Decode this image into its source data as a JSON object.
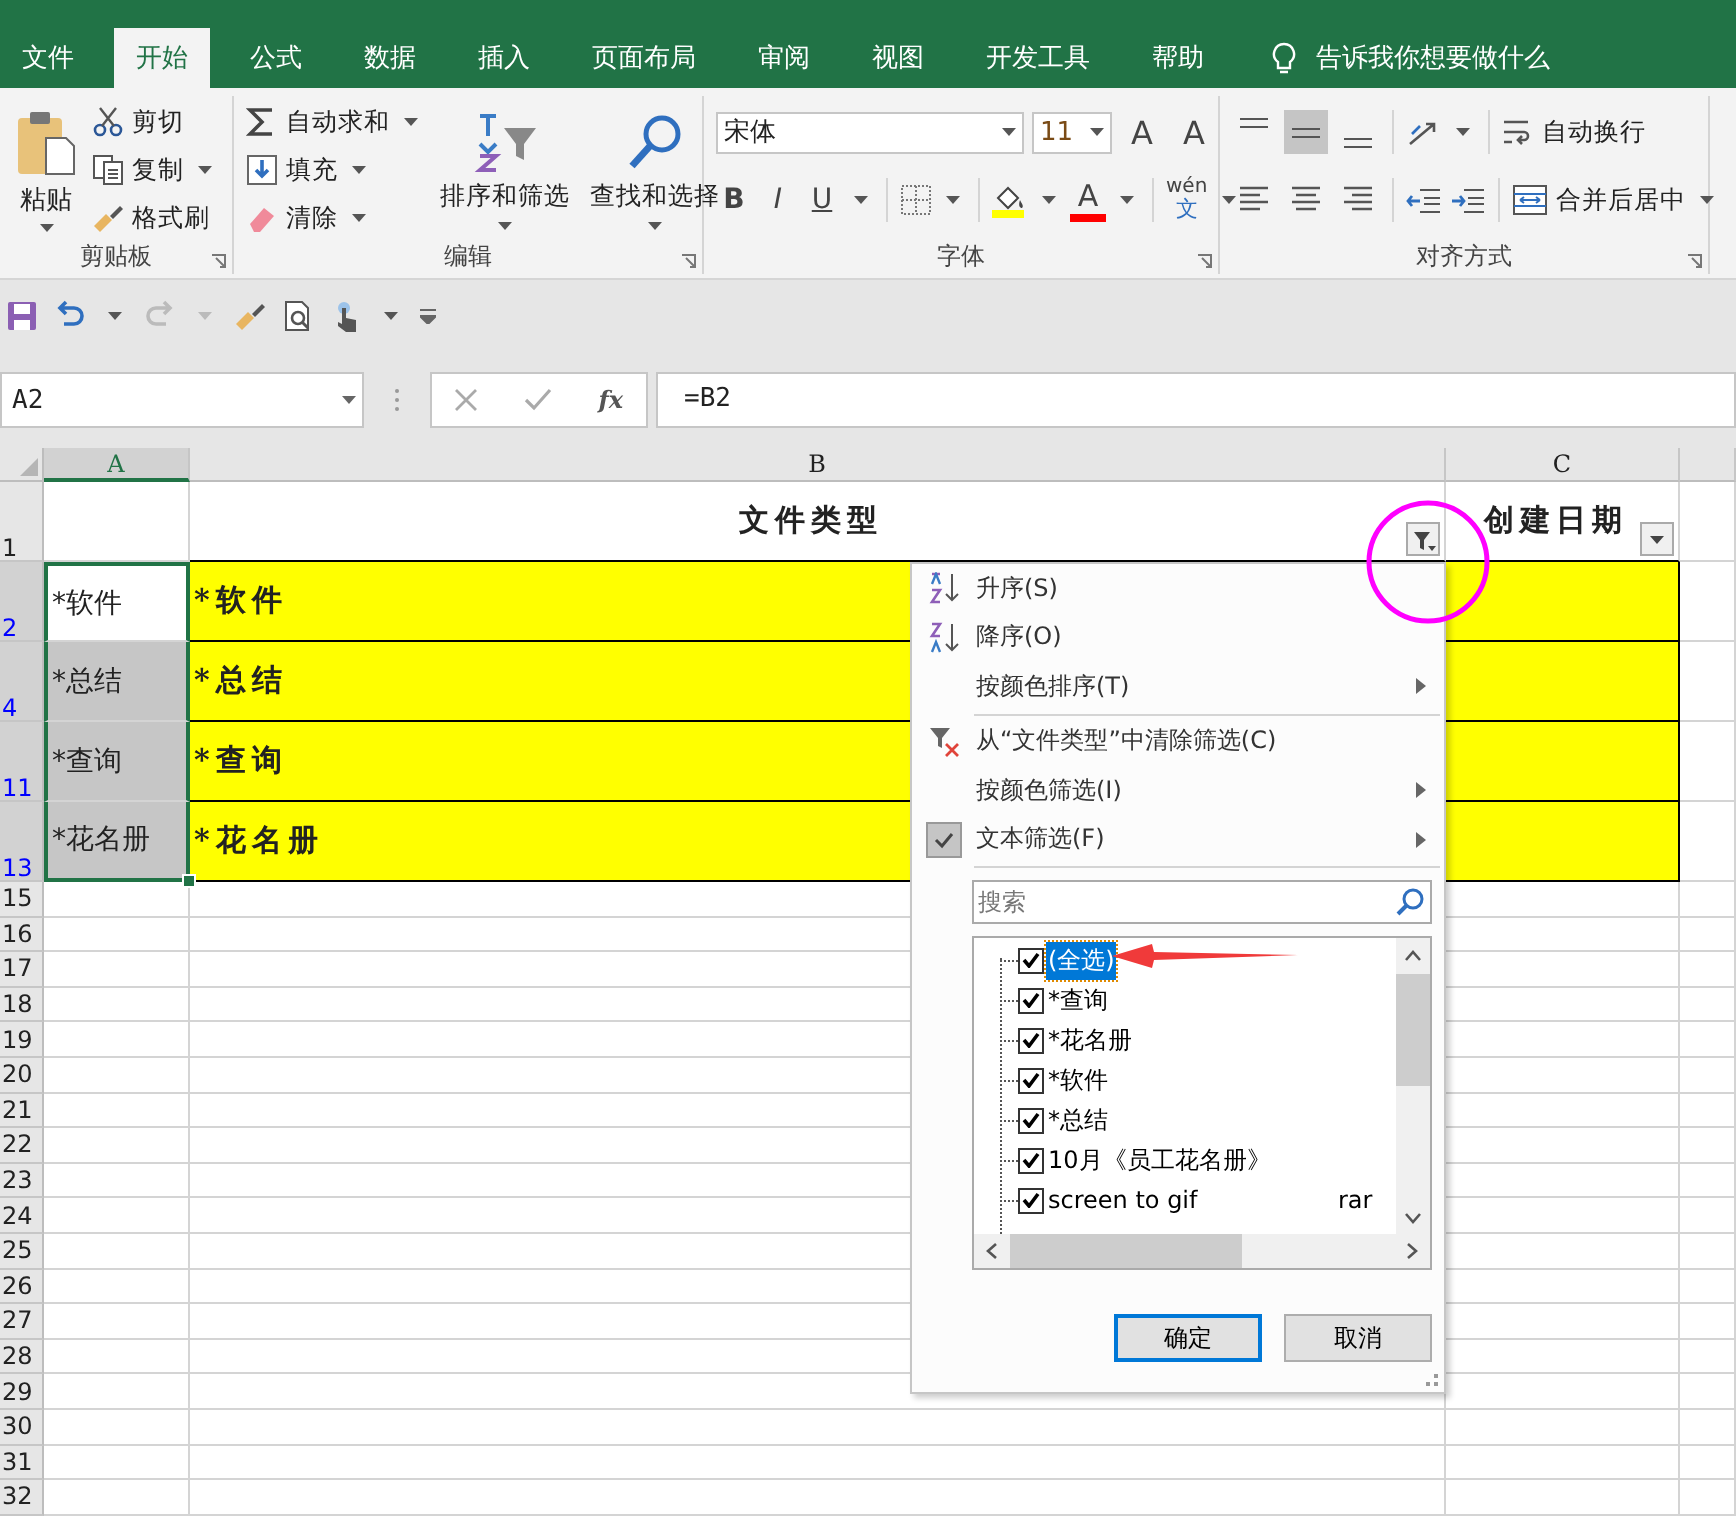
{
  "ribbon_tabs": [
    {
      "label": "文件",
      "selected": false
    },
    {
      "label": "开始",
      "selected": true
    },
    {
      "label": "公式",
      "selected": false
    },
    {
      "label": "数据",
      "selected": false
    },
    {
      "label": "插入",
      "selected": false
    },
    {
      "label": "页面布局",
      "selected": false
    },
    {
      "label": "审阅",
      "selected": false
    },
    {
      "label": "视图",
      "selected": false
    },
    {
      "label": "开发工具",
      "selected": false
    },
    {
      "label": "帮助",
      "selected": false
    }
  ],
  "tell_me": "告诉我你想要做什么",
  "clipboard": {
    "title": "剪贴板",
    "paste": "粘贴",
    "cut": "剪切",
    "copy": "复制",
    "format_painter": "格式刷"
  },
  "editing": {
    "title": "编辑",
    "autosum": "自动求和",
    "fill": "填充",
    "clear": "清除",
    "sort_filter": "排序和筛选",
    "find_select": "查找和选择"
  },
  "font": {
    "title": "字体",
    "name": "宋体",
    "size": "11",
    "grow": "A",
    "shrink": "A",
    "bold": "B",
    "italic": "I",
    "underline": "U",
    "font_color": "A",
    "phonetic_top": "wén",
    "phonetic_bottom": "文"
  },
  "alignment": {
    "title": "对齐方式",
    "wrap": "自动换行",
    "merge": "合并后居中",
    "vertical": [
      {
        "kind": "top",
        "selected": false
      },
      {
        "kind": "middle",
        "selected": true
      },
      {
        "kind": "bottom",
        "selected": false
      }
    ],
    "horizontal": [
      {
        "kind": "left",
        "selected": false
      },
      {
        "kind": "center",
        "selected": false
      },
      {
        "kind": "right",
        "selected": false
      }
    ]
  },
  "formula_bar": {
    "name_box": "A2",
    "fx": "fx",
    "formula": "=B2"
  },
  "sheet": {
    "columns": [
      {
        "label": "A",
        "selected": true
      },
      {
        "label": "B",
        "selected": false
      },
      {
        "label": "C",
        "selected": false
      }
    ],
    "rows": [
      {
        "num": "1",
        "kind": "header",
        "filtered": false,
        "cells": [
          {
            "selected": false
          },
          {
            "text": "文件类型",
            "filter_applied": true
          },
          {
            "text": "创建日期",
            "filter_applied": false
          }
        ]
      },
      {
        "num": "2",
        "kind": "data",
        "filtered": true,
        "cells": [
          {
            "text": "*软件",
            "selected": true,
            "active": true
          },
          {
            "text": "*软件",
            "highlighted": true
          },
          {
            "highlighted": true
          }
        ]
      },
      {
        "num": "4",
        "kind": "data",
        "filtered": true,
        "cells": [
          {
            "text": "*总结",
            "selected": true,
            "active": false
          },
          {
            "text": "*总结",
            "highlighted": true
          },
          {
            "highlighted": true
          }
        ]
      },
      {
        "num": "11",
        "kind": "data",
        "filtered": true,
        "cells": [
          {
            "text": "*查询",
            "selected": true,
            "active": false
          },
          {
            "text": "*查询",
            "highlighted": true
          },
          {
            "highlighted": true
          }
        ]
      },
      {
        "num": "13",
        "kind": "data",
        "filtered": true,
        "cells": [
          {
            "text": "*花名册",
            "selected": true,
            "active": false
          },
          {
            "text": "*花名册",
            "highlighted": true
          },
          {
            "highlighted": true
          }
        ]
      },
      {
        "num": "15",
        "kind": "empty",
        "filtered": false
      },
      {
        "num": "16",
        "kind": "empty",
        "filtered": false
      },
      {
        "num": "17",
        "kind": "empty",
        "filtered": false
      },
      {
        "num": "18",
        "kind": "empty",
        "filtered": false
      },
      {
        "num": "19",
        "kind": "empty",
        "filtered": false
      },
      {
        "num": "20",
        "kind": "empty",
        "filtered": false
      },
      {
        "num": "21",
        "kind": "empty",
        "filtered": false
      },
      {
        "num": "22",
        "kind": "empty",
        "filtered": false
      },
      {
        "num": "23",
        "kind": "empty",
        "filtered": false
      },
      {
        "num": "24",
        "kind": "empty",
        "filtered": false
      },
      {
        "num": "25",
        "kind": "empty",
        "filtered": false
      },
      {
        "num": "26",
        "kind": "empty",
        "filtered": false
      },
      {
        "num": "27",
        "kind": "empty",
        "filtered": false
      },
      {
        "num": "28",
        "kind": "empty",
        "filtered": false
      },
      {
        "num": "29",
        "kind": "empty",
        "filtered": false
      },
      {
        "num": "30",
        "kind": "empty",
        "filtered": false
      },
      {
        "num": "31",
        "kind": "empty",
        "filtered": false
      },
      {
        "num": "32",
        "kind": "empty",
        "filtered": false
      }
    ]
  },
  "filter_menu": {
    "items": [
      {
        "kind": "sort-asc",
        "label": "升序(S)",
        "submenu": false,
        "checked": false
      },
      {
        "kind": "sort-desc",
        "label": "降序(O)",
        "submenu": false,
        "checked": false
      },
      {
        "kind": "plain",
        "label": "按颜色排序(T)",
        "submenu": true,
        "checked": false
      },
      {
        "kind": "separator"
      },
      {
        "kind": "clear-filter",
        "label": "从“文件类型”中清除筛选(C)",
        "submenu": false,
        "checked": false
      },
      {
        "kind": "plain",
        "label": "按颜色筛选(I)",
        "submenu": true,
        "checked": false
      },
      {
        "kind": "plain",
        "label": "文本筛选(F)",
        "submenu": true,
        "checked": true
      }
    ],
    "search": {
      "placeholder": "搜索"
    },
    "values": [
      {
        "label": "(全选)",
        "checked": true,
        "selected": true
      },
      {
        "label": "*查询",
        "checked": true,
        "selected": false
      },
      {
        "label": "*花名册",
        "checked": true,
        "selected": false
      },
      {
        "label": "*软件",
        "checked": true,
        "selected": false
      },
      {
        "label": "*总结",
        "checked": true,
        "selected": false
      },
      {
        "label": "10月《员工花名册》",
        "checked": true,
        "selected": false
      },
      {
        "label": "screen to gif",
        "note": "rar",
        "checked": true,
        "selected": false
      }
    ],
    "buttons": [
      {
        "label": "确定",
        "default": true
      },
      {
        "label": "取消",
        "default": false
      }
    ]
  }
}
